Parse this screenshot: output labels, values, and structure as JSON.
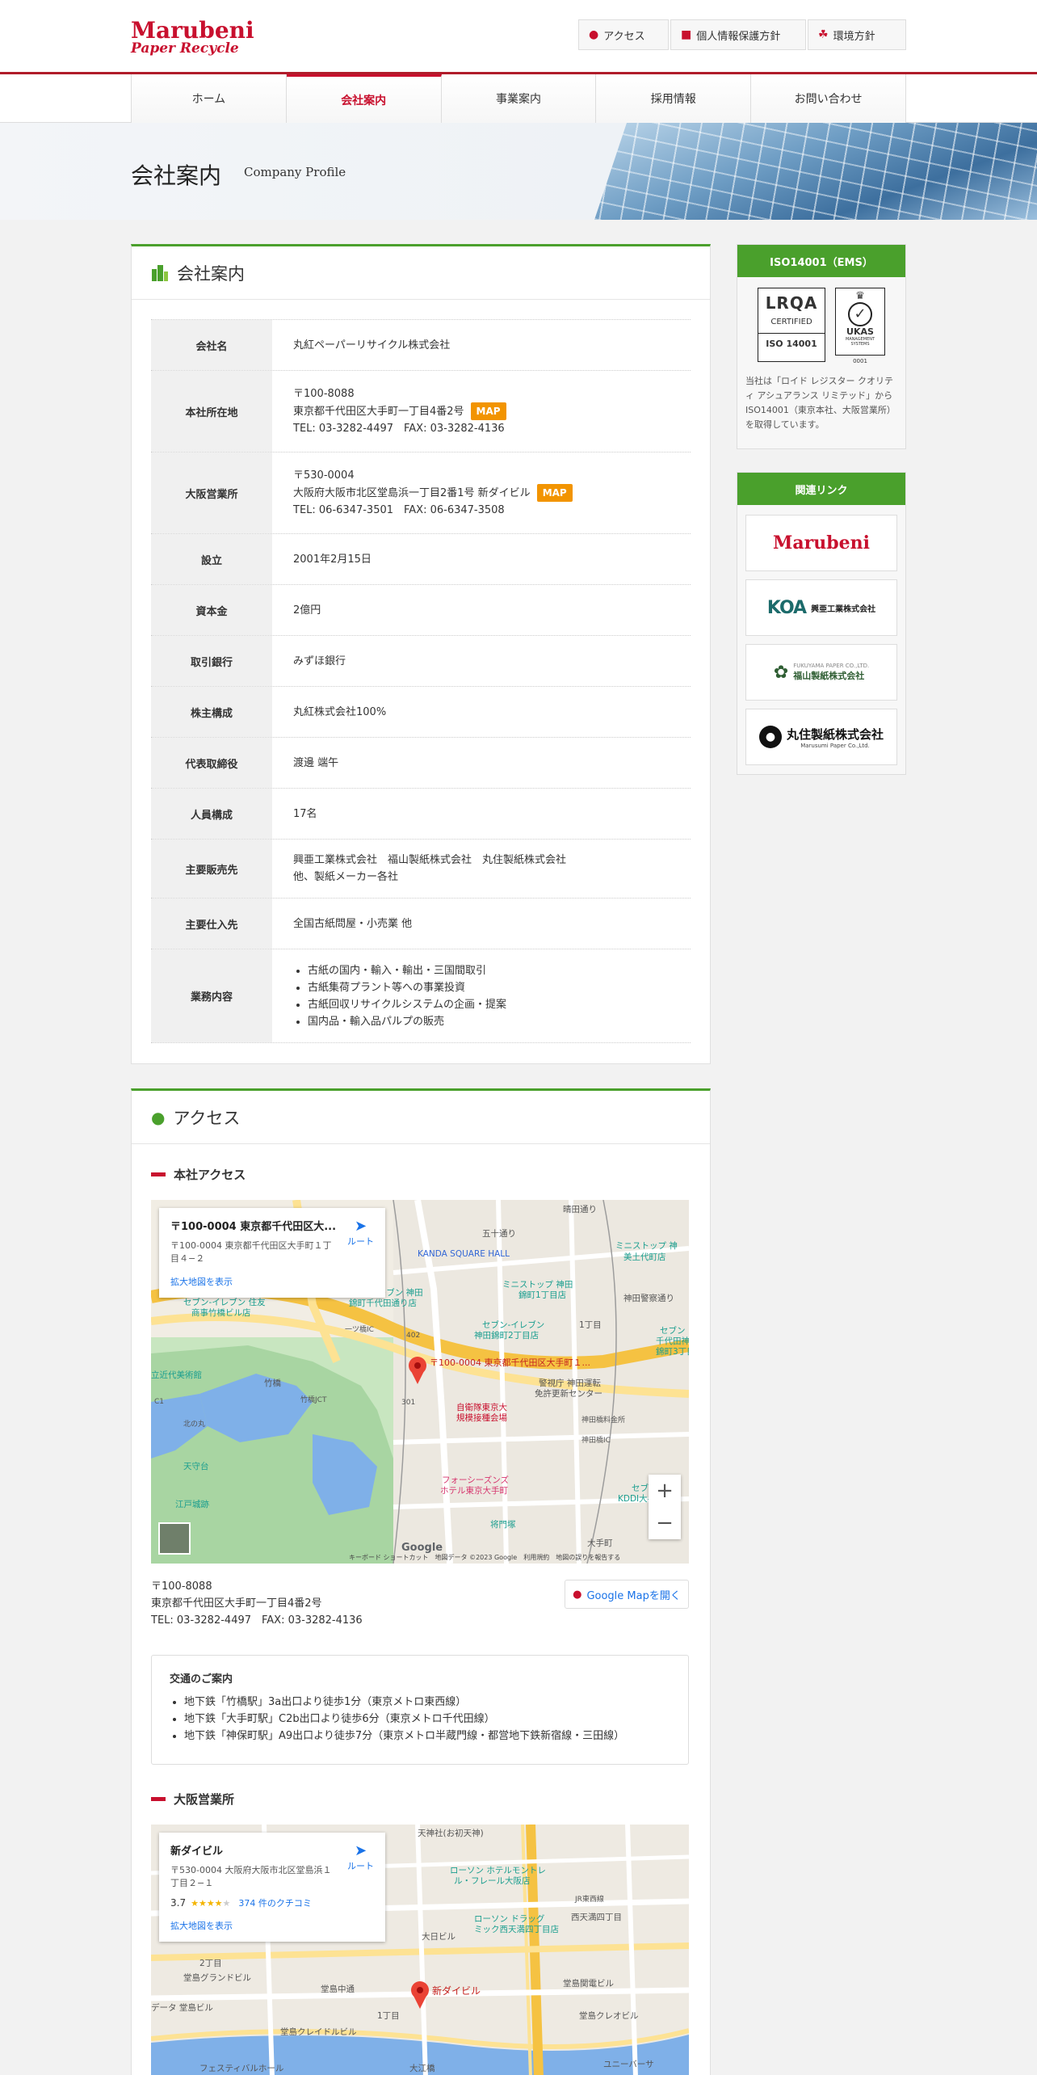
{
  "header": {
    "logo_line1": "Marubeni",
    "logo_line2": "Paper Recycle",
    "util_links": [
      {
        "label": "アクセス",
        "icon": "map-pin-icon"
      },
      {
        "label": "個人情報保護方針",
        "icon": "lock-icon"
      },
      {
        "label": "環境方針",
        "icon": "leaf-hand-icon"
      }
    ]
  },
  "nav": {
    "items": [
      "ホーム",
      "会社案内",
      "事業案内",
      "採用情報",
      "お問い合わせ"
    ],
    "active": "会社案内"
  },
  "banner": {
    "title": "会社案内",
    "subtitle": "Company Profile"
  },
  "company": {
    "heading": "会社案内",
    "map_label": "MAP",
    "rows": {
      "name": {
        "label": "会社名",
        "value": "丸紅ペーパーリサイクル株式会社"
      },
      "hq": {
        "label": "本社所在地",
        "zip": "〒100-8088",
        "address": "東京都千代田区大手町一丁目4番2号",
        "tel": "TEL: 03-3282-4497　FAX: 03-3282-4136"
      },
      "osaka": {
        "label": "大阪営業所",
        "zip": "〒530-0004",
        "address": "大阪府大阪市北区堂島浜一丁目2番1号 新ダイビル",
        "tel": "TEL: 06-6347-3501　FAX: 06-6347-3508"
      },
      "founded": {
        "label": "設立",
        "value": "2001年2月15日"
      },
      "capital": {
        "label": "資本金",
        "value": "2億円"
      },
      "bank": {
        "label": "取引銀行",
        "value": "みずほ銀行"
      },
      "shareholders": {
        "label": "株主構成",
        "value": "丸紅株式会社100%"
      },
      "ceo": {
        "label": "代表取締役",
        "value": "渡邊 端午"
      },
      "staff": {
        "label": "人員構成",
        "value": "17名"
      },
      "customers": {
        "label": "主要販売先",
        "line1": "興亜工業株式会社　福山製紙株式会社　丸住製紙株式会社",
        "line2": "他、製紙メーカー各社"
      },
      "suppliers": {
        "label": "主要仕入先",
        "value": "全国古紙問屋・小売業 他"
      },
      "business": {
        "label": "業務内容",
        "items": [
          "古紙の国内・輸入・輸出・三国間取引",
          "古紙集荷プラント等への事業投資",
          "古紙回収リサイクルシステムの企画・提案",
          "国内品・輸入品パルプの販売"
        ]
      }
    }
  },
  "access": {
    "heading": "アクセス",
    "hq": {
      "subheading": "本社アクセス",
      "card_title": "〒100-0004 東京都千代田区大...",
      "card_address": "〒100-0004 東京都千代田区大手町１丁目４−２",
      "route_label": "ルート",
      "enlarge_label": "拡大地図を表示",
      "pin_label": "〒100-0004 東京都千代田区大手町１...",
      "map_labels": [
        "KANDA SQUARE HALL",
        "五十通り",
        "晴田通り",
        "ミニストップ 神田",
        "美土代町店",
        "セブン-イレブン 神田",
        "錦町千代田通り店",
        "ミニストップ 神田",
        "錦町1丁目店",
        "神田警察通り",
        "1丁目",
        "セブン-イレブン",
        "神田錦町2丁目店",
        "セブン-イレブン",
        "千代田神田",
        "錦町3丁目店",
        "警視庁 神田運転",
        "免許更新センター",
        "神田橋料金所",
        "神田橋IC",
        "自衛隊東京大",
        "規模接種会場",
        "フォーシーズンズ",
        "ホテル東京大手町",
        "セブン",
        "KDDI大手",
        "大手町",
        "将門塚",
        "天守台",
        "江戸城跡",
        "竹橋",
        "竹橋JCT",
        "一ツ橋IC",
        "北の丸",
        "立近代美術館",
        "セブン-イレブン 住友",
        "商事竹橋ビル店",
        "402",
        "301",
        "C1"
      ],
      "attribution": "キーボード ショートカット　地図データ ©2023 Google　利用規約　地図の誤りを報告する",
      "zoom_in": "+",
      "zoom_out": "−",
      "addr_zip": "〒100-8088",
      "addr_line": "東京都千代田区大手町一丁目4番2号",
      "addr_tel": "TEL: 03-3282-4497　FAX: 03-3282-4136",
      "gmap_button": "Google Mapを開く",
      "traffic_title": "交通のご案内",
      "traffic_items": [
        "地下鉄「竹橋駅」3a出口より徒歩1分（東京メトロ東西線）",
        "地下鉄「大手町駅」C2b出口より徒歩6分（東京メトロ千代田線）",
        "地下鉄「神保町駅」A9出口より徒歩7分（東京メトロ半蔵門線・都営地下鉄新宿線・三田線）"
      ]
    },
    "osaka": {
      "subheading": "大阪営業所",
      "card_title": "新ダイビル",
      "card_address": "〒530-0004 大阪府大阪市北区堂島浜１丁目２−１",
      "rating": "3.7",
      "reviews": "374 件のクチコミ",
      "route_label": "ルート",
      "enlarge_label": "拡大地図を表示",
      "pin_label": "新ダイビル",
      "map_labels": [
        "天神社(お初天神)",
        "ローソン ホテルモントレ",
        "ル・フレール大阪店",
        "JR東西線",
        "ローソン ドラッグ",
        "ミック西天満四丁目店",
        "西天満四丁目",
        "大日ビル",
        "堂島グランドビル",
        "堂島中通",
        "2丁目",
        "1丁目",
        "新ダイビル",
        "データ 堂島ビル",
        "堂島関電ビル",
        "堂島クレオビル",
        "堂島クレイドルビル",
        "フェスティバルホール",
        "大江橋",
        "ユニーバーサ"
      ]
    }
  },
  "sidebar": {
    "iso_head": "ISO14001（EMS）",
    "lrqa_lines": [
      "LRQA",
      "CERTIFIED",
      "ISO 14001"
    ],
    "ukas_lines": [
      "UKAS",
      "MANAGEMENT",
      "SYSTEMS",
      "0001"
    ],
    "iso_text": "当社は「ロイド レジスター クオリティ アシュアランス リミテッド」からISO14001（東京本社、大阪営業所）を取得しています。",
    "links_head": "関連リンク",
    "links": [
      {
        "name": "Marubeni"
      },
      {
        "name": "興亜工業株式会社",
        "mark": "KOA"
      },
      {
        "name": "福山製紙株式会社",
        "en": "FUKUYAMA PAPER CO.,LTD."
      },
      {
        "name": "丸住製紙株式会社",
        "en": "Marusumi Paper Co.,Ltd."
      }
    ]
  },
  "colors": {
    "brand_red": "#c8102e",
    "green": "#4aa02c",
    "map_orange": "#f29400",
    "link_blue": "#1a73e8"
  }
}
